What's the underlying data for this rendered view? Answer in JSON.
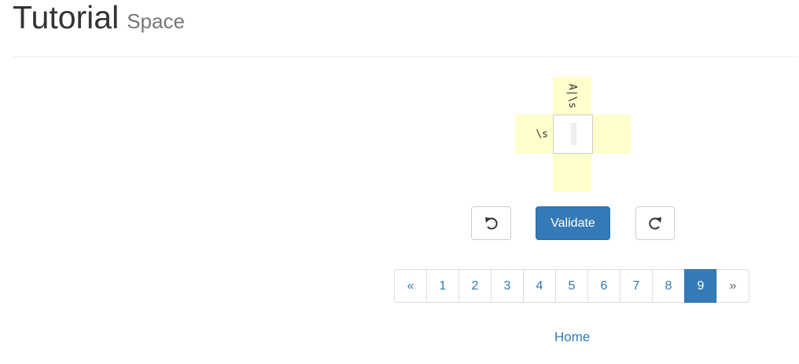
{
  "header": {
    "title": "Tutorial",
    "subtitle": "Space"
  },
  "puzzle": {
    "top_hint": "A|\\s",
    "left_hint": "\\s",
    "right_hint": "",
    "bottom_hint": "",
    "cell_value": ""
  },
  "controls": {
    "undo_icon": "undo-icon",
    "validate_label": "Validate",
    "redo_icon": "redo-icon"
  },
  "pagination": {
    "prev": "«",
    "pages": [
      "1",
      "2",
      "3",
      "4",
      "5",
      "6",
      "7",
      "8",
      "9"
    ],
    "active": "9",
    "next": "»"
  },
  "footer": {
    "home_link": "Home"
  },
  "colors": {
    "accent": "#337ab7",
    "hint_bg": "#ffffcc"
  }
}
